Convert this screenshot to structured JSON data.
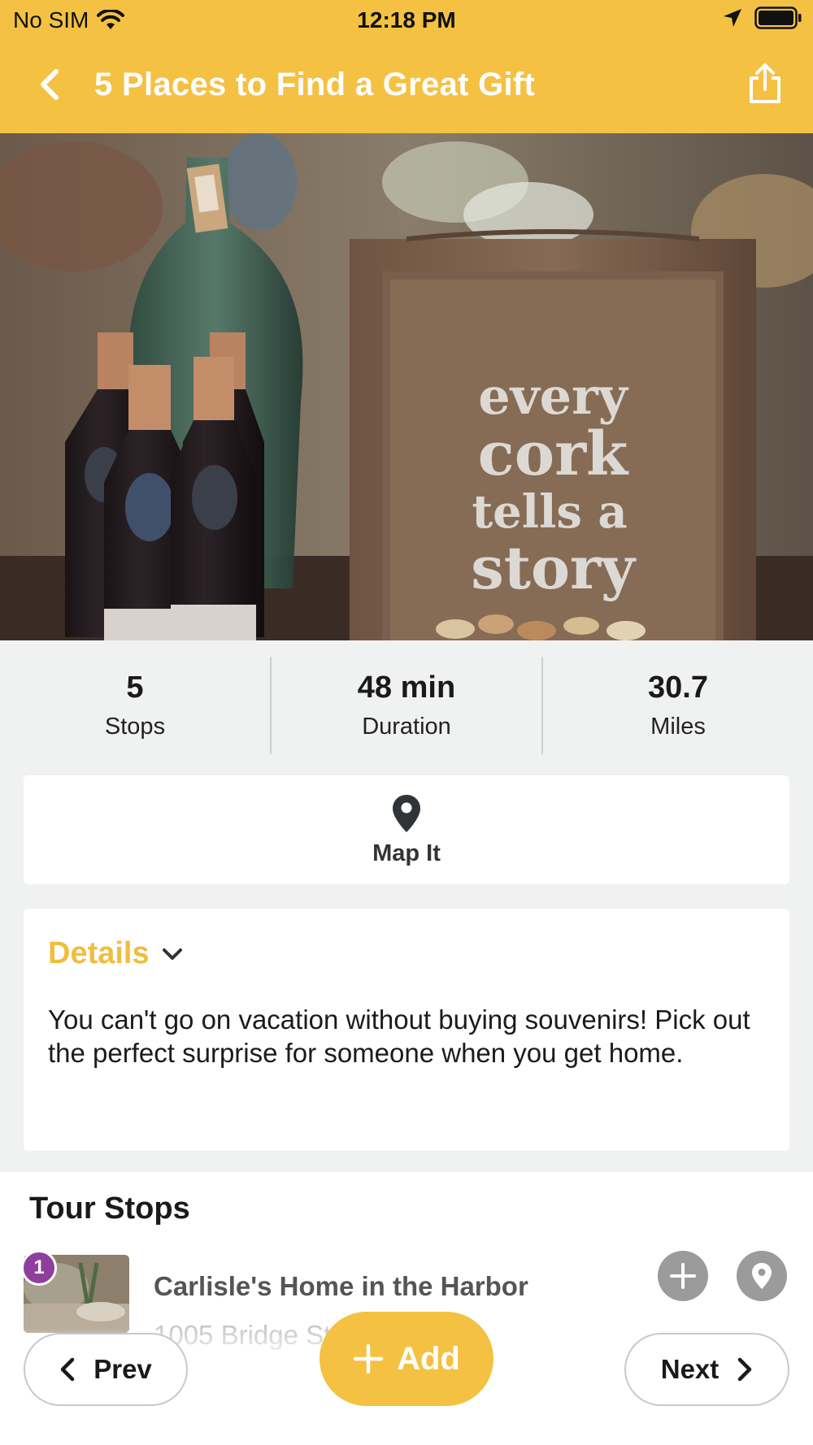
{
  "status_bar": {
    "carrier": "No SIM",
    "time": "12:18 PM"
  },
  "nav": {
    "title": "5 Places to Find a Great Gift"
  },
  "hero": {
    "sign_lines": [
      "every",
      "cork",
      "tells a",
      "story"
    ]
  },
  "stats": [
    {
      "value": "5",
      "label": "Stops"
    },
    {
      "value": "48 min",
      "label": "Duration"
    },
    {
      "value": "30.7",
      "label": "Miles"
    }
  ],
  "map_it": {
    "label": "Map It"
  },
  "details": {
    "title": "Details",
    "body": "You can't go on vacation without buying souvenirs! Pick out the perfect surprise for someone when you get home."
  },
  "tour_stops": {
    "heading": "Tour Stops",
    "items": [
      {
        "number": "1",
        "name": "Carlisle's Home in the Harbor",
        "address": "1005 Bridge St"
      }
    ]
  },
  "footer": {
    "prev_label": "Prev",
    "add_label": "Add",
    "next_label": "Next"
  },
  "colors": {
    "accent": "#f4c142",
    "badge": "#8e3f9b"
  }
}
